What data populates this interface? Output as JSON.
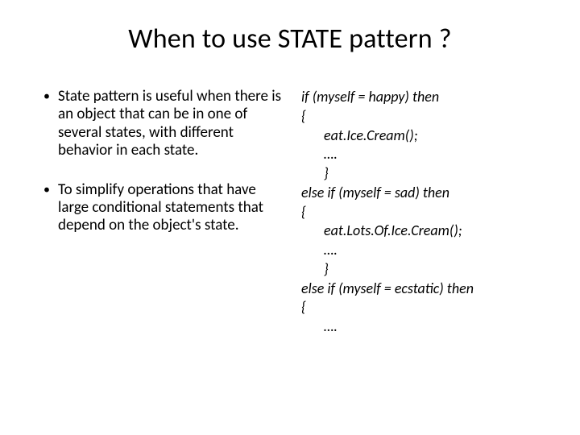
{
  "title": "When to use STATE pattern ?",
  "bullets": [
    "State pattern is useful when there is an object that can be in one of several states, with different behavior in each state.",
    "To simplify operations that have large conditional statements that depend on the object's state."
  ],
  "code": {
    "l1": "if (myself = happy) then",
    "l2": "{",
    "l3": "eat.Ice.Cream();",
    "l4": "….",
    "l5": "}",
    "l6": "else if (myself = sad) then",
    "l7": "{",
    "l8": "eat.Lots.Of.Ice.Cream();",
    "l9": "….",
    "l10": "}",
    "l11": "else if (myself = ecstatic) then",
    "l12": "{",
    "l13": "…."
  }
}
